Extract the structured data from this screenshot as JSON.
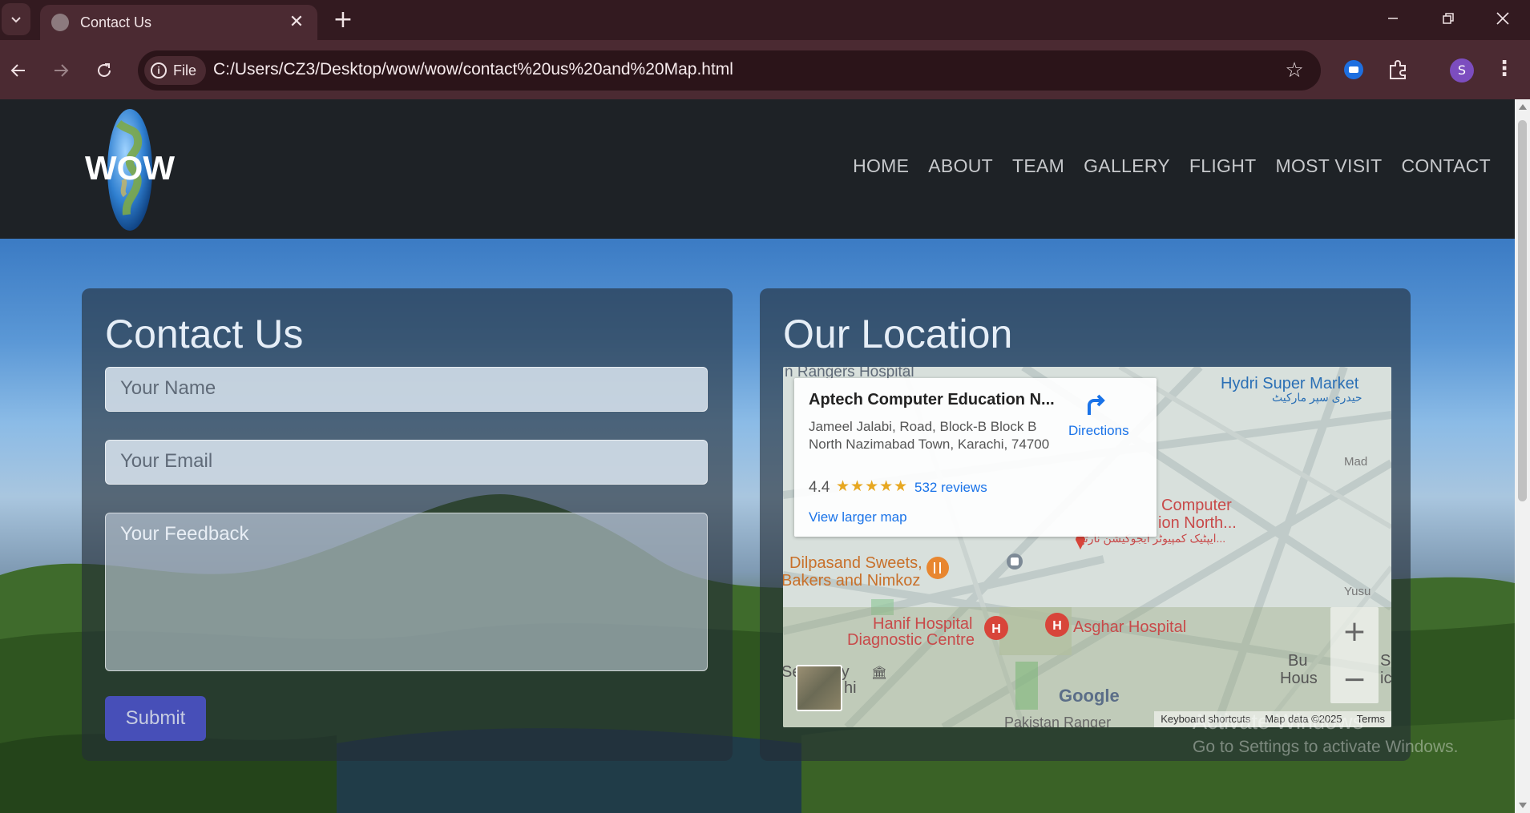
{
  "browser": {
    "tab_title": "Contact Us",
    "chip_label": "File",
    "url": "C:/Users/CZ3/Desktop/wow/wow/contact%20us%20and%20Map.html",
    "profile_initial": "S",
    "accent": "#4b2a32"
  },
  "site": {
    "logo_text": "WOW",
    "nav": [
      "HOME",
      "ABOUT",
      "TEAM",
      "GALLERY",
      "FLIGHT",
      "MOST VISIT",
      "CONTACT"
    ]
  },
  "contact": {
    "heading": "Contact Us",
    "name_placeholder": "Your Name",
    "email_placeholder": "Your Email",
    "feedback_placeholder": "Your Feedback",
    "submit_label": "Submit",
    "submit_color": "#4b52c8"
  },
  "location": {
    "heading": "Our Location",
    "place_title": "Aptech Computer Education N...",
    "address": "Jameel Jalabi, Road, Block-B Block B North Nazimabad Town, Karachi, 74700",
    "rating": "4.4",
    "stars": "★★★★★",
    "reviews": "532 reviews",
    "view_larger": "View larger map",
    "directions": "Directions",
    "map_labels": {
      "rangers": "n Rangers Hospital",
      "hydri": "Hydri Super Market",
      "hydri_urdu": "حیدری سپر مارکیٹ",
      "computer": "Computer",
      "ion_north": "ion North...",
      "aptech_urdu": "ایپٹیک کمپیوٹر ایجوکیشن نارتھ...",
      "dilpasand": "Dilpasand Sweets,",
      "bakers": "Bakers and Nimkoz",
      "hanif": "Hanif Hospital",
      "diagnostic": "Diagnostic Centre",
      "asghar": "Asghar Hospital",
      "pakistan_rangers": "Pakistan Ranger",
      "bu": "Bu",
      "hous": "Hous",
      "yusuf": "Yusu",
      "made": "Mad",
      "se": "Se",
      "ry": "ry",
      "hi": "hi",
      "sh": "Sh",
      "ic": "ic"
    },
    "google": "Google",
    "keyboard": "Keyboard shortcuts",
    "map_data": "Map data ©2025",
    "terms": "Terms",
    "zoom_in": "+",
    "zoom_out": "−"
  },
  "watermark": {
    "line1": "Activate Windows",
    "line2": "Go to Settings to activate Windows."
  }
}
